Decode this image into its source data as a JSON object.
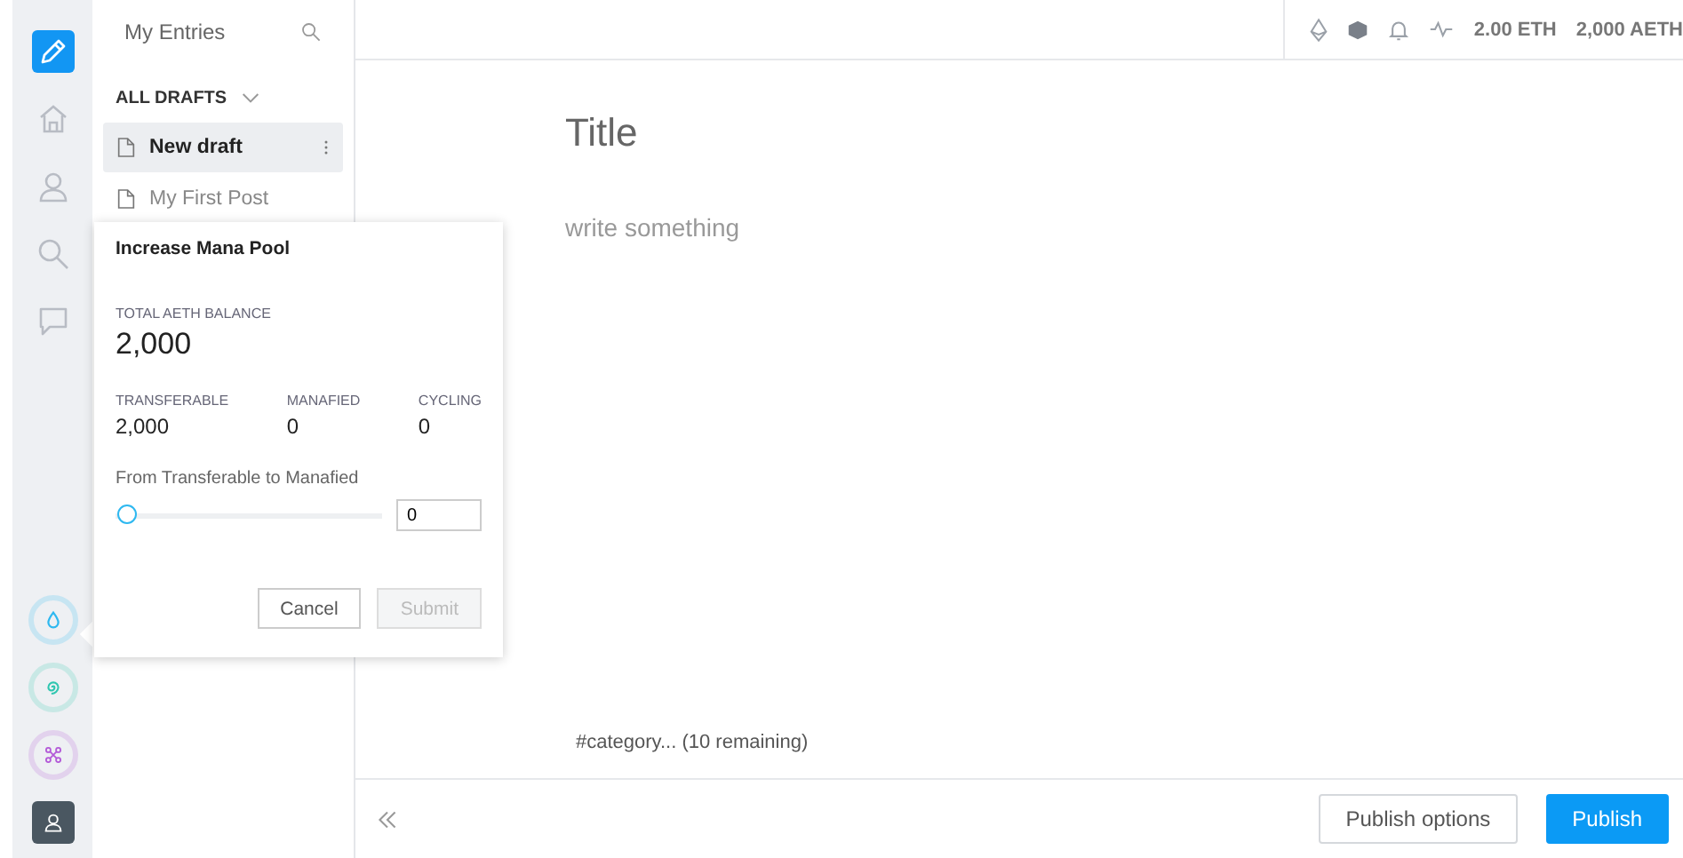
{
  "rail": {
    "items": [
      {
        "kind": "pencil",
        "selected": true
      },
      {
        "kind": "home",
        "selected": false
      },
      {
        "kind": "user",
        "selected": false
      },
      {
        "kind": "search",
        "selected": false
      },
      {
        "kind": "chat",
        "selected": false
      }
    ],
    "tokens": [
      {
        "kind": "drop",
        "color": "#2eb8f0"
      },
      {
        "kind": "spiral",
        "color": "#30c6b0"
      },
      {
        "kind": "network",
        "color": "#b35ad8"
      }
    ]
  },
  "entries": {
    "title": "My Entries",
    "section": "ALL DRAFTS",
    "items": [
      {
        "label": "New draft",
        "selected": true
      },
      {
        "label": "My First Post",
        "selected": false
      }
    ]
  },
  "topbar": {
    "eth": "2.00 ETH",
    "aeth": "2,000 AETH"
  },
  "editor": {
    "title_placeholder": "Title",
    "body_placeholder": "write something",
    "tags_placeholder": "#category... (10 remaining)"
  },
  "footer": {
    "buttons": [
      {
        "label": "Publish options",
        "kind": "secondary"
      },
      {
        "label": "Publish",
        "kind": "primary"
      }
    ]
  },
  "popover": {
    "title": "Increase Mana Pool",
    "balance_label": "TOTAL AETH BALANCE",
    "balance": "2,000",
    "stats": [
      {
        "label": "TRANSFERABLE",
        "value": "2,000"
      },
      {
        "label": "MANAFIED",
        "value": "0"
      },
      {
        "label": "CYCLING",
        "value": "0"
      }
    ],
    "slider_label": "From Transferable to Manafied",
    "slider": {
      "level": 0
    },
    "amount": "0",
    "buttons": [
      {
        "label": "Cancel",
        "disabled": false
      },
      {
        "label": "Submit",
        "disabled": true
      }
    ]
  }
}
